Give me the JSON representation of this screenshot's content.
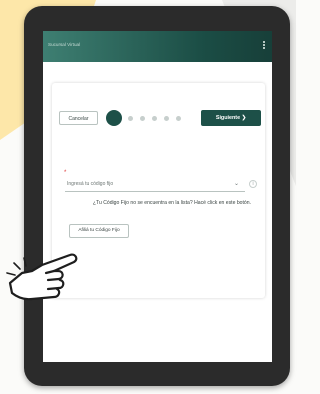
{
  "colors": {
    "accent": "#1d5048",
    "background_yellow": "#fde7a9",
    "tablet_frame": "#2b2b2b"
  },
  "appbar": {
    "title": "Sucursal Virtual",
    "menu_icon": "vertical-dots-icon"
  },
  "stepper": {
    "cancel_label": "Cancelar",
    "next_label": "Siguiente",
    "next_icon": "chevron-right-icon",
    "current_step": 1,
    "total_steps": 6
  },
  "form": {
    "required_marker": "*",
    "select_placeholder": "Ingresá tu código fijo",
    "help_icon": "info-icon",
    "hint_text": "¿Tu Código Fijo no se encuentra en la lista? Hacé click en este botón.",
    "affiliate_button_label": "Afiliá tu Código Fijo"
  },
  "overlay": {
    "cursor_icon": "hand-pointer-icon"
  }
}
